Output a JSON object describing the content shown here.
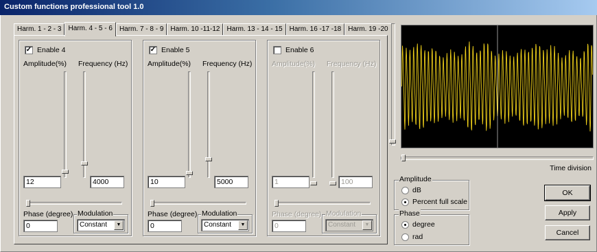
{
  "window": {
    "title": "Custom functions professional tool 1.0"
  },
  "tabs": [
    {
      "label": "Harm. 1 - 2 - 3",
      "active": false
    },
    {
      "label": "Harm. 4 - 5 - 6",
      "active": true
    },
    {
      "label": "Harm. 7 - 8 - 9",
      "active": false
    },
    {
      "label": "Harm. 10 -11-12",
      "active": false
    },
    {
      "label": "Harm. 13 - 14 - 15",
      "active": false
    },
    {
      "label": "Harm. 16 -17 -18",
      "active": false
    },
    {
      "label": "Harm. 19 -20",
      "active": false
    }
  ],
  "harmonics": [
    {
      "enable_label": "Enable 4",
      "enabled": true,
      "amplitude_label": "Amplitude(%)",
      "frequency_label": "Frequency (Hz)",
      "amplitude_value": "12",
      "frequency_value": "4000",
      "phase_label": "Phase (degree)",
      "phase_value": "0",
      "modulation_label": "Modulation",
      "modulation_value": "Constant"
    },
    {
      "enable_label": "Enable 5",
      "enabled": true,
      "amplitude_label": "Amplitude(%)",
      "frequency_label": "Frequency (Hz)",
      "amplitude_value": "10",
      "frequency_value": "5000",
      "phase_label": "Phase (degree)",
      "phase_value": "0",
      "modulation_label": "Modulation",
      "modulation_value": "Constant"
    },
    {
      "enable_label": "Enable 6",
      "enabled": false,
      "amplitude_label": "Amplitude(%)",
      "frequency_label": "Frequency (Hz)",
      "amplitude_value": "1",
      "frequency_value": "100",
      "phase_label": "Phase (degree)",
      "phase_value": "0",
      "modulation_label": "Modulation",
      "modulation_value": "Constant"
    }
  ],
  "scope": {
    "time_division_label": "Time division",
    "trace_color": "#f2d21a",
    "background_color": "#000000"
  },
  "amplitude_group": {
    "legend": "Amplitude",
    "options": [
      {
        "label": "dB",
        "selected": false
      },
      {
        "label": "Percent full scale",
        "selected": true
      }
    ]
  },
  "phase_group": {
    "legend": "Phase",
    "options": [
      {
        "label": "degree",
        "selected": true
      },
      {
        "label": "rad",
        "selected": false
      }
    ]
  },
  "buttons": {
    "ok": "OK",
    "apply": "Apply",
    "cancel": "Cancel"
  }
}
